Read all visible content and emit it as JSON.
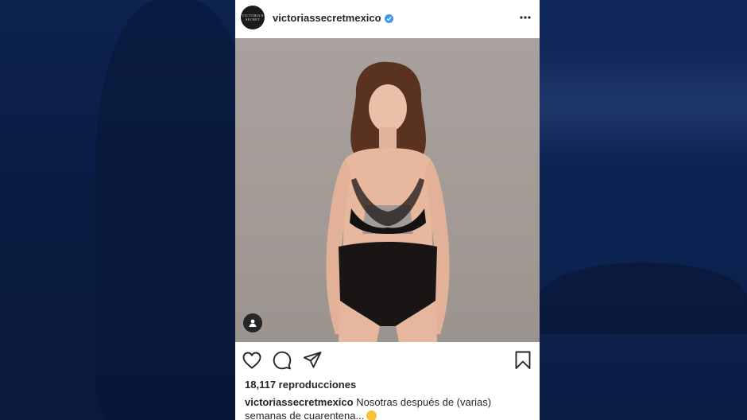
{
  "post": {
    "username": "victoriassecretmexico",
    "avatar_text": "VICTORIA'S SECRET",
    "verified": true,
    "views": "18,117 reproducciones",
    "caption_user": "victoriassecretmexico",
    "caption_line1": "Nosotras después de (varias)",
    "caption_line2": "semanas de cuarentena...",
    "caption_emoji": "woozy-face-emoji"
  },
  "icons": {
    "more": "more-dots-icon",
    "like": "heart-icon",
    "comment": "comment-bubble-icon",
    "share": "paper-plane-icon",
    "save": "bookmark-icon",
    "tagged": "person-icon"
  },
  "colors": {
    "text": "#262626",
    "verified": "#3897f0",
    "backdrop": "#0b1e44",
    "media_bg": "#a29a95"
  }
}
